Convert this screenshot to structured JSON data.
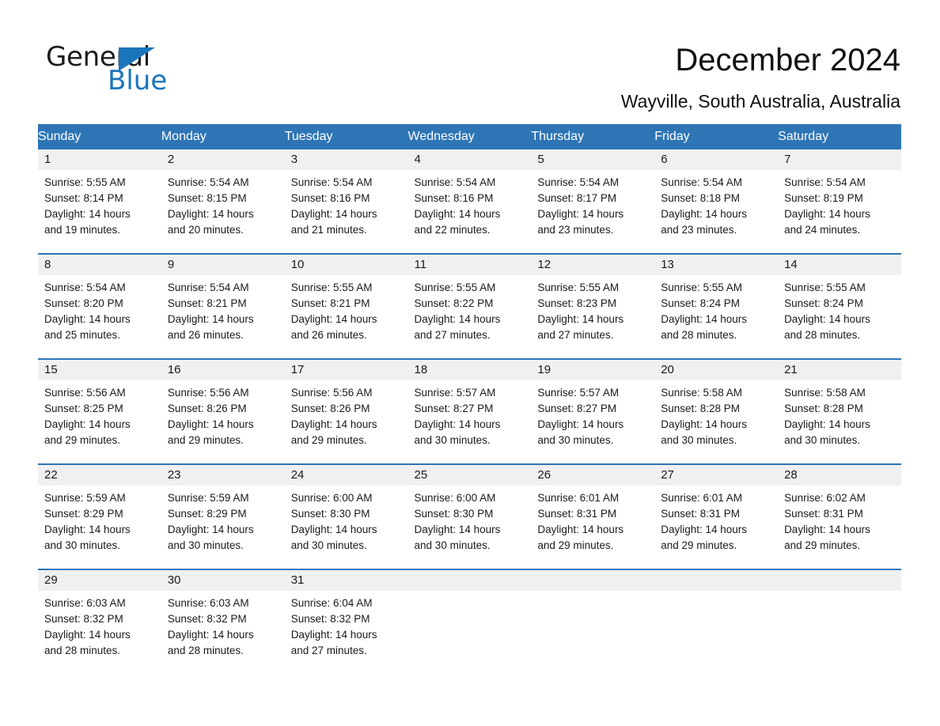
{
  "brand": {
    "name_part1": "General",
    "name_part2": "Blue",
    "triangle_color": "#1b75bb"
  },
  "header": {
    "title": "December 2024",
    "subtitle": "Wayville, South Australia, Australia"
  },
  "theme": {
    "header_blue": "#2e75b6",
    "daynum_gray": "#f0f0f0",
    "text": "#1a1a1a"
  },
  "calendar": {
    "weekday_headers": [
      "Sunday",
      "Monday",
      "Tuesday",
      "Wednesday",
      "Thursday",
      "Friday",
      "Saturday"
    ],
    "weeks": [
      [
        {
          "day": "1",
          "sunrise": "Sunrise: 5:55 AM",
          "sunset": "Sunset: 8:14 PM",
          "daylight_line1": "Daylight: 14 hours",
          "daylight_line2": "and 19 minutes."
        },
        {
          "day": "2",
          "sunrise": "Sunrise: 5:54 AM",
          "sunset": "Sunset: 8:15 PM",
          "daylight_line1": "Daylight: 14 hours",
          "daylight_line2": "and 20 minutes."
        },
        {
          "day": "3",
          "sunrise": "Sunrise: 5:54 AM",
          "sunset": "Sunset: 8:16 PM",
          "daylight_line1": "Daylight: 14 hours",
          "daylight_line2": "and 21 minutes."
        },
        {
          "day": "4",
          "sunrise": "Sunrise: 5:54 AM",
          "sunset": "Sunset: 8:16 PM",
          "daylight_line1": "Daylight: 14 hours",
          "daylight_line2": "and 22 minutes."
        },
        {
          "day": "5",
          "sunrise": "Sunrise: 5:54 AM",
          "sunset": "Sunset: 8:17 PM",
          "daylight_line1": "Daylight: 14 hours",
          "daylight_line2": "and 23 minutes."
        },
        {
          "day": "6",
          "sunrise": "Sunrise: 5:54 AM",
          "sunset": "Sunset: 8:18 PM",
          "daylight_line1": "Daylight: 14 hours",
          "daylight_line2": "and 23 minutes."
        },
        {
          "day": "7",
          "sunrise": "Sunrise: 5:54 AM",
          "sunset": "Sunset: 8:19 PM",
          "daylight_line1": "Daylight: 14 hours",
          "daylight_line2": "and 24 minutes."
        }
      ],
      [
        {
          "day": "8",
          "sunrise": "Sunrise: 5:54 AM",
          "sunset": "Sunset: 8:20 PM",
          "daylight_line1": "Daylight: 14 hours",
          "daylight_line2": "and 25 minutes."
        },
        {
          "day": "9",
          "sunrise": "Sunrise: 5:54 AM",
          "sunset": "Sunset: 8:21 PM",
          "daylight_line1": "Daylight: 14 hours",
          "daylight_line2": "and 26 minutes."
        },
        {
          "day": "10",
          "sunrise": "Sunrise: 5:55 AM",
          "sunset": "Sunset: 8:21 PM",
          "daylight_line1": "Daylight: 14 hours",
          "daylight_line2": "and 26 minutes."
        },
        {
          "day": "11",
          "sunrise": "Sunrise: 5:55 AM",
          "sunset": "Sunset: 8:22 PM",
          "daylight_line1": "Daylight: 14 hours",
          "daylight_line2": "and 27 minutes."
        },
        {
          "day": "12",
          "sunrise": "Sunrise: 5:55 AM",
          "sunset": "Sunset: 8:23 PM",
          "daylight_line1": "Daylight: 14 hours",
          "daylight_line2": "and 27 minutes."
        },
        {
          "day": "13",
          "sunrise": "Sunrise: 5:55 AM",
          "sunset": "Sunset: 8:24 PM",
          "daylight_line1": "Daylight: 14 hours",
          "daylight_line2": "and 28 minutes."
        },
        {
          "day": "14",
          "sunrise": "Sunrise: 5:55 AM",
          "sunset": "Sunset: 8:24 PM",
          "daylight_line1": "Daylight: 14 hours",
          "daylight_line2": "and 28 minutes."
        }
      ],
      [
        {
          "day": "15",
          "sunrise": "Sunrise: 5:56 AM",
          "sunset": "Sunset: 8:25 PM",
          "daylight_line1": "Daylight: 14 hours",
          "daylight_line2": "and 29 minutes."
        },
        {
          "day": "16",
          "sunrise": "Sunrise: 5:56 AM",
          "sunset": "Sunset: 8:26 PM",
          "daylight_line1": "Daylight: 14 hours",
          "daylight_line2": "and 29 minutes."
        },
        {
          "day": "17",
          "sunrise": "Sunrise: 5:56 AM",
          "sunset": "Sunset: 8:26 PM",
          "daylight_line1": "Daylight: 14 hours",
          "daylight_line2": "and 29 minutes."
        },
        {
          "day": "18",
          "sunrise": "Sunrise: 5:57 AM",
          "sunset": "Sunset: 8:27 PM",
          "daylight_line1": "Daylight: 14 hours",
          "daylight_line2": "and 30 minutes."
        },
        {
          "day": "19",
          "sunrise": "Sunrise: 5:57 AM",
          "sunset": "Sunset: 8:27 PM",
          "daylight_line1": "Daylight: 14 hours",
          "daylight_line2": "and 30 minutes."
        },
        {
          "day": "20",
          "sunrise": "Sunrise: 5:58 AM",
          "sunset": "Sunset: 8:28 PM",
          "daylight_line1": "Daylight: 14 hours",
          "daylight_line2": "and 30 minutes."
        },
        {
          "day": "21",
          "sunrise": "Sunrise: 5:58 AM",
          "sunset": "Sunset: 8:28 PM",
          "daylight_line1": "Daylight: 14 hours",
          "daylight_line2": "and 30 minutes."
        }
      ],
      [
        {
          "day": "22",
          "sunrise": "Sunrise: 5:59 AM",
          "sunset": "Sunset: 8:29 PM",
          "daylight_line1": "Daylight: 14 hours",
          "daylight_line2": "and 30 minutes."
        },
        {
          "day": "23",
          "sunrise": "Sunrise: 5:59 AM",
          "sunset": "Sunset: 8:29 PM",
          "daylight_line1": "Daylight: 14 hours",
          "daylight_line2": "and 30 minutes."
        },
        {
          "day": "24",
          "sunrise": "Sunrise: 6:00 AM",
          "sunset": "Sunset: 8:30 PM",
          "daylight_line1": "Daylight: 14 hours",
          "daylight_line2": "and 30 minutes."
        },
        {
          "day": "25",
          "sunrise": "Sunrise: 6:00 AM",
          "sunset": "Sunset: 8:30 PM",
          "daylight_line1": "Daylight: 14 hours",
          "daylight_line2": "and 30 minutes."
        },
        {
          "day": "26",
          "sunrise": "Sunrise: 6:01 AM",
          "sunset": "Sunset: 8:31 PM",
          "daylight_line1": "Daylight: 14 hours",
          "daylight_line2": "and 29 minutes."
        },
        {
          "day": "27",
          "sunrise": "Sunrise: 6:01 AM",
          "sunset": "Sunset: 8:31 PM",
          "daylight_line1": "Daylight: 14 hours",
          "daylight_line2": "and 29 minutes."
        },
        {
          "day": "28",
          "sunrise": "Sunrise: 6:02 AM",
          "sunset": "Sunset: 8:31 PM",
          "daylight_line1": "Daylight: 14 hours",
          "daylight_line2": "and 29 minutes."
        }
      ],
      [
        {
          "day": "29",
          "sunrise": "Sunrise: 6:03 AM",
          "sunset": "Sunset: 8:32 PM",
          "daylight_line1": "Daylight: 14 hours",
          "daylight_line2": "and 28 minutes."
        },
        {
          "day": "30",
          "sunrise": "Sunrise: 6:03 AM",
          "sunset": "Sunset: 8:32 PM",
          "daylight_line1": "Daylight: 14 hours",
          "daylight_line2": "and 28 minutes."
        },
        {
          "day": "31",
          "sunrise": "Sunrise: 6:04 AM",
          "sunset": "Sunset: 8:32 PM",
          "daylight_line1": "Daylight: 14 hours",
          "daylight_line2": "and 27 minutes."
        },
        {
          "day": "",
          "sunrise": "",
          "sunset": "",
          "daylight_line1": "",
          "daylight_line2": ""
        },
        {
          "day": "",
          "sunrise": "",
          "sunset": "",
          "daylight_line1": "",
          "daylight_line2": ""
        },
        {
          "day": "",
          "sunrise": "",
          "sunset": "",
          "daylight_line1": "",
          "daylight_line2": ""
        },
        {
          "day": "",
          "sunrise": "",
          "sunset": "",
          "daylight_line1": "",
          "daylight_line2": ""
        }
      ]
    ]
  }
}
